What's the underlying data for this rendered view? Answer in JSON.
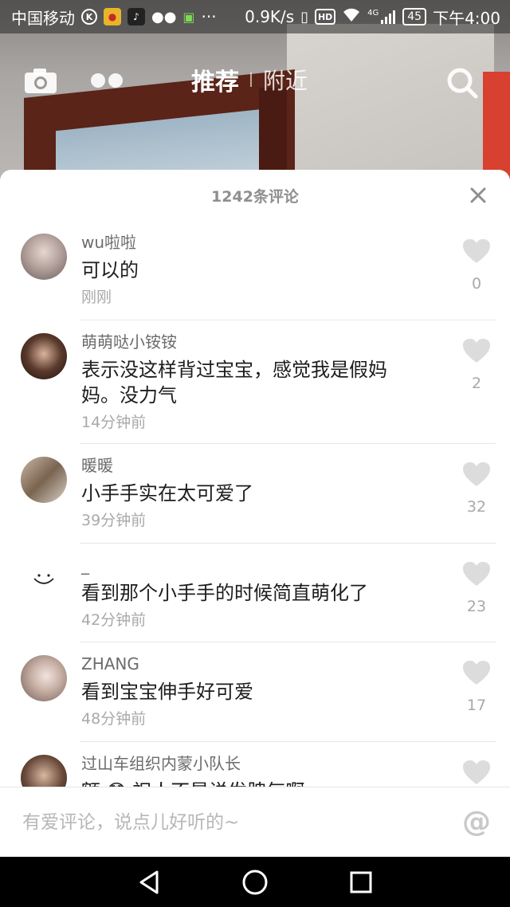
{
  "status_bar": {
    "carrier": "中国移动",
    "net_speed": "0.9K/s",
    "hd": "HD",
    "signal": "4G",
    "battery": "45",
    "time": "下午4:00",
    "more": "···"
  },
  "top_nav": {
    "tabs": [
      {
        "label": "推荐",
        "active": true
      },
      {
        "label": "附近",
        "active": false
      }
    ]
  },
  "sheet": {
    "title": "1242条评论",
    "comments": [
      {
        "user": "wu啦啦",
        "text": "可以的",
        "time": "刚刚",
        "likes": "0"
      },
      {
        "user": "萌萌哒小铵铵",
        "text": "表示没这样背过宝宝，感觉我是假妈妈。没力气",
        "time": "14分钟前",
        "likes": "2"
      },
      {
        "user": "暖暖",
        "text": "小手手实在太可爱了",
        "time": "39分钟前",
        "likes": "32"
      },
      {
        "user": "_",
        "text": "看到那个小手手的时候简直萌化了",
        "time": "42分钟前",
        "likes": "23"
      },
      {
        "user": "ZHANG",
        "text": "看到宝宝伸手好可爱",
        "time": "48分钟前",
        "likes": "17"
      },
      {
        "user": "过山车组织内蒙小队长",
        "text": "额 😳 祝人不是说发脾气啊",
        "time": "",
        "likes": ""
      }
    ]
  },
  "input": {
    "placeholder": "有爱评论，说点儿好听的~",
    "at_symbol": "@"
  }
}
